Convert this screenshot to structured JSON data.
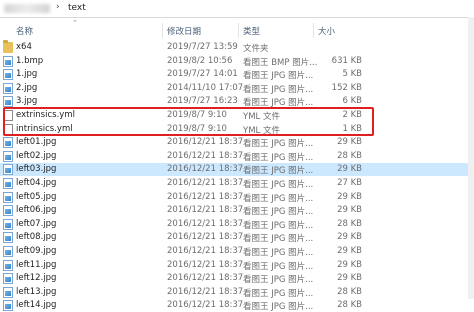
{
  "address": {
    "separator": "›",
    "path": "text"
  },
  "columns": {
    "name": "名称",
    "date": "修改日期",
    "type": "类型",
    "size": "大小"
  },
  "files": [
    {
      "name": "x64",
      "date": "2019/7/27 13:59",
      "type": "文件夹",
      "size": "",
      "icon": "folder-icon"
    },
    {
      "name": "1.bmp",
      "date": "2019/8/2 10:56",
      "type": "看图王 BMP 图片...",
      "size": "631 KB",
      "icon": "image-file-icon"
    },
    {
      "name": "1.jpg",
      "date": "2019/7/27 14:01",
      "type": "看图王 JPG 图片...",
      "size": "5 KB",
      "icon": "image-file-icon"
    },
    {
      "name": "2.jpg",
      "date": "2014/11/10 17:07",
      "type": "看图王 JPG 图片...",
      "size": "152 KB",
      "icon": "image-file-icon"
    },
    {
      "name": "3.jpg",
      "date": "2019/7/27 16:23",
      "type": "看图王 JPG 图片...",
      "size": "6 KB",
      "icon": "image-file-icon"
    },
    {
      "name": "extrinsics.yml",
      "date": "2019/8/7 9:10",
      "type": "YML 文件",
      "size": "2 KB",
      "icon": "document-icon"
    },
    {
      "name": "intrinsics.yml",
      "date": "2019/8/7 9:10",
      "type": "YML 文件",
      "size": "1 KB",
      "icon": "document-icon"
    },
    {
      "name": "left01.jpg",
      "date": "2016/12/21 18:37",
      "type": "看图王 JPG 图片...",
      "size": "29 KB",
      "icon": "image-file-icon"
    },
    {
      "name": "left02.jpg",
      "date": "2016/12/21 18:37",
      "type": "看图王 JPG 图片...",
      "size": "28 KB",
      "icon": "image-file-icon"
    },
    {
      "name": "left03.jpg",
      "date": "2016/12/21 18:37",
      "type": "看图王 JPG 图片...",
      "size": "29 KB",
      "icon": "image-file-icon"
    },
    {
      "name": "left04.jpg",
      "date": "2016/12/21 18:37",
      "type": "看图王 JPG 图片...",
      "size": "27 KB",
      "icon": "image-file-icon"
    },
    {
      "name": "left05.jpg",
      "date": "2016/12/21 18:37",
      "type": "看图王 JPG 图片...",
      "size": "29 KB",
      "icon": "image-file-icon"
    },
    {
      "name": "left06.jpg",
      "date": "2016/12/21 18:37",
      "type": "看图王 JPG 图片...",
      "size": "29 KB",
      "icon": "image-file-icon"
    },
    {
      "name": "left07.jpg",
      "date": "2016/12/21 18:37",
      "type": "看图王 JPG 图片...",
      "size": "28 KB",
      "icon": "image-file-icon"
    },
    {
      "name": "left08.jpg",
      "date": "2016/12/21 18:37",
      "type": "看图王 JPG 图片...",
      "size": "29 KB",
      "icon": "image-file-icon"
    },
    {
      "name": "left09.jpg",
      "date": "2016/12/21 18:37",
      "type": "看图王 JPG 图片...",
      "size": "29 KB",
      "icon": "image-file-icon"
    },
    {
      "name": "left11.jpg",
      "date": "2016/12/21 18:37",
      "type": "看图王 JPG 图片...",
      "size": "29 KB",
      "icon": "image-file-icon"
    },
    {
      "name": "left12.jpg",
      "date": "2016/12/21 18:37",
      "type": "看图王 JPG 图片...",
      "size": "29 KB",
      "icon": "image-file-icon"
    },
    {
      "name": "left13.jpg",
      "date": "2016/12/21 18:37",
      "type": "看图王 JPG 图片...",
      "size": "28 KB",
      "icon": "image-file-icon"
    },
    {
      "name": "left14.jpg",
      "date": "2016/12/21 18:37",
      "type": "看图王 JPG 图片...",
      "size": "28 KB",
      "icon": "image-file-icon"
    }
  ],
  "selected_index": 9,
  "colors": {
    "selection": "#cce8ff",
    "highlight_box": "#e02020",
    "header_text": "#4c607a"
  }
}
